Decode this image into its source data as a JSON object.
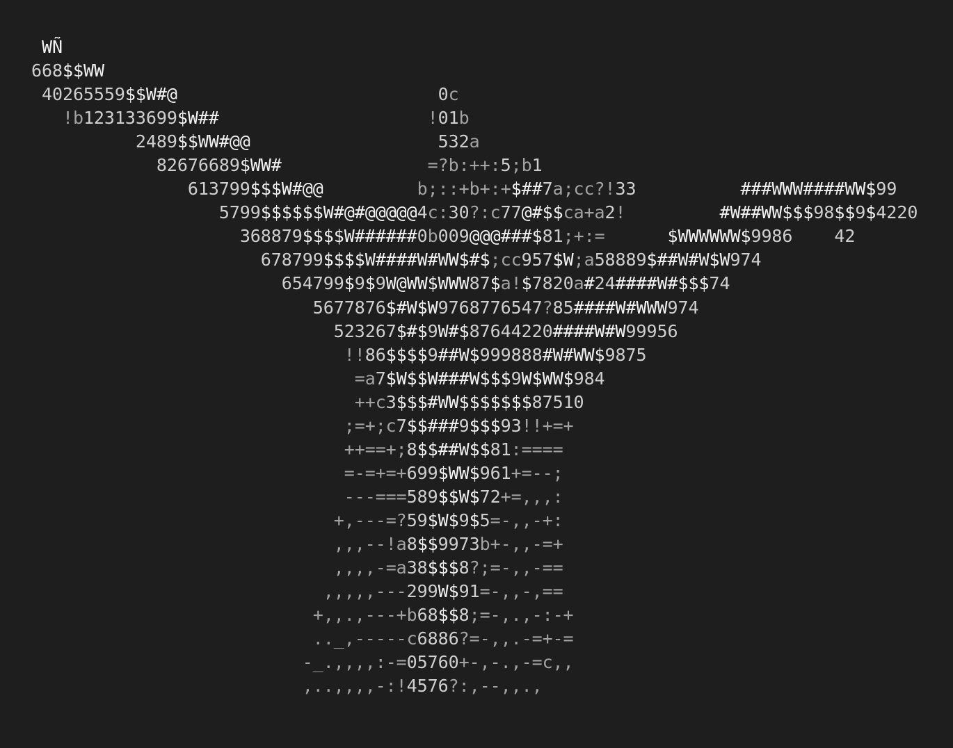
{
  "art": {
    "lines": [
      "    WÑ",
      "   668$$WW",
      "    40265559$$W#@                         0c",
      "      !b123133699$W##                    !01b",
      "             2489$$WW#@@                  532a",
      "               82676689$WW#              =?b:++:5;b1",
      "                  613799$$$W#@@         b;::+b+:+$##7a;cc?!33          ###WWW####WW$99",
      "                     5799$$$$$$W#@#@@@@@4c:30?:c77@#$$ca+a2!         #W##WW$$$98$$9$4220",
      "                       368879$$$$W######0b009@@@###$81;+:=      $WWWWWW$9986    42",
      "                         678799$$$$W####W#WW$#$;cc957$W;a58889$##W#W$W974",
      "                           654799$9$9W@WW$WWW87$a!$7820a#24####W#$$$74",
      "                              5677876$#W$W9768776547?85####W#WWW974",
      "                                523267$#$9W#$87644220####W#W99956",
      "                                 !!86$$$$9##W$999888#W#WW$9875",
      "                                  =a7$W$$W###W$$$9W$WW$984",
      "                                  ++c3$$$#WW$$$$$$$87510",
      "                                 ;=+;c7$$###9$$$93!!+=+",
      "                                 ++==+;8$$##W$$81:====",
      "                                 =-=+=+699$WW$961+=--;",
      "                                 ---===589$$W$72+=,,,:",
      "                                +,---=?59$W$9$5=-,,-+:",
      "                                ,,,--!a8$$9973b+-,,-=+",
      "                                ,,,,-=a38$$$8?;=-,,-==",
      "                               ,,,,,---299W$91=-,,-,==",
      "                              +,,.,---+b68$$8;=-,.,-:-+",
      "                              .._,-----c6886?=-,,.-=+-=",
      "                             -_.,,,,:-=05760+-,-.,-=c,,",
      "                             ,..,,,,-:!4576?:,--,,.,"
    ]
  }
}
